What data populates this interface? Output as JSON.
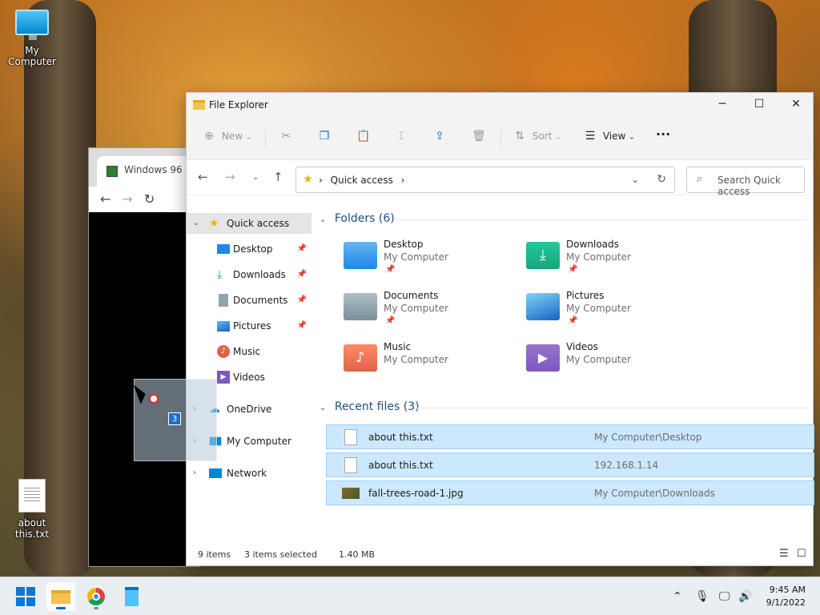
{
  "desktop": {
    "icons": [
      {
        "label": "My Computer"
      },
      {
        "label": "about this.txt"
      }
    ]
  },
  "background_window": {
    "tab_title": "Windows 96"
  },
  "explorer": {
    "title": "File Explorer",
    "window_controls": {
      "minimize": "─",
      "maximize": "☐",
      "close": "✕"
    },
    "commands": {
      "new_label": "New",
      "sort_label": "Sort",
      "view_label": "View",
      "more_label": "···"
    },
    "address": {
      "crumb": "Quick access",
      "sep": "›",
      "search_placeholder": "Search Quick access"
    },
    "sidebar": {
      "items": [
        {
          "label": "Quick access",
          "icon": "star-icon"
        },
        {
          "label": "Desktop",
          "icon": "desktop-folder-icon",
          "pinned": true
        },
        {
          "label": "Downloads",
          "icon": "download-icon",
          "pinned": true
        },
        {
          "label": "Documents",
          "icon": "documents-icon",
          "pinned": true
        },
        {
          "label": "Pictures",
          "icon": "pictures-icon",
          "pinned": true
        },
        {
          "label": "Music",
          "icon": "music-icon"
        },
        {
          "label": "Videos",
          "icon": "videos-icon"
        },
        {
          "label": "OneDrive",
          "icon": "cloud-icon"
        },
        {
          "label": "My Computer",
          "icon": "computer-icon"
        },
        {
          "label": "Network",
          "icon": "network-icon"
        }
      ]
    },
    "folders_header": "Folders (6)",
    "folders": [
      {
        "name": "Desktop",
        "location": "My Computer",
        "pinned": true,
        "color": "#1e88e5"
      },
      {
        "name": "Downloads",
        "location": "My Computer",
        "pinned": true,
        "color": "#17a67a"
      },
      {
        "name": "Documents",
        "location": "My Computer",
        "pinned": true,
        "color": "#78909c"
      },
      {
        "name": "Pictures",
        "location": "My Computer",
        "pinned": true,
        "color": "#1e88e5"
      },
      {
        "name": "Music",
        "location": "My Computer",
        "pinned": false,
        "color": "#e0634a"
      },
      {
        "name": "Videos",
        "location": "My Computer",
        "pinned": false,
        "color": "#7e57c2"
      }
    ],
    "recent_header": "Recent files (3)",
    "recent": [
      {
        "name": "about this.txt",
        "location": "My Computer\\Desktop",
        "type": "txt"
      },
      {
        "name": "about this.txt",
        "location": "192.168.1.14",
        "type": "txt"
      },
      {
        "name": "fall-trees-road-1.jpg",
        "location": "My Computer\\Downloads",
        "type": "jpg"
      }
    ],
    "status": {
      "items": "9 items",
      "selected": "3 items selected",
      "size": "1.40 MB"
    }
  },
  "drag": {
    "count": "3"
  },
  "taskbar": {
    "time": "9:45 AM",
    "date": "9/1/2022",
    "accent": "#0a64c8"
  }
}
